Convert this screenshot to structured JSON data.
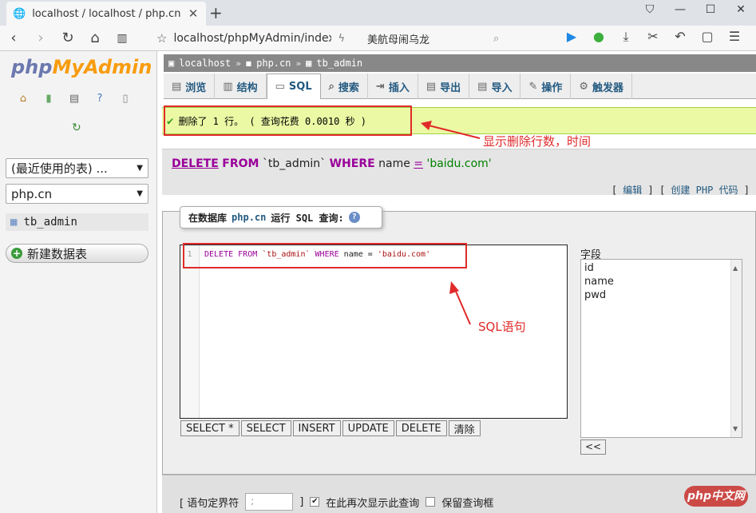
{
  "browser": {
    "tab_title": "localhost / localhost / php.cn / tb",
    "url": "localhost/phpMyAdmin/index.p",
    "search_text": "美航母闹乌龙"
  },
  "sidebar": {
    "logo_php": "php",
    "logo_myadmin": "MyAdmin",
    "recent_tables": "(最近使用的表) ...",
    "database": "php.cn",
    "table": "tb_admin",
    "new_table": "新建数据表"
  },
  "breadcrumb": {
    "server": "localhost",
    "database": "php.cn",
    "table": "tb_admin"
  },
  "tabs": [
    "浏览",
    "结构",
    "SQL",
    "搜索",
    "插入",
    "导出",
    "导入",
    "操作",
    "触发器"
  ],
  "message": "删除了 1 行。 ( 查询花费 0.0010 秒 )",
  "annotation_delete": "显示删除行数，时间",
  "annotation_sql": "SQL语句",
  "query_display": {
    "delete": "DELETE",
    "from": "FROM",
    "table": "`tb_admin`",
    "where": "WHERE",
    "col": "name",
    "eq": "=",
    "value": "'baidu.com'"
  },
  "edit_links": {
    "edit": "编辑",
    "create_php": "创建 PHP 代码"
  },
  "sql_panel": {
    "legend_prefix": "在数据库",
    "legend_db": "php.cn",
    "legend_suffix": "运行 SQL 查询:",
    "line_number": "1",
    "code": {
      "delete": "DELETE",
      "from": "FROM",
      "table": "`tb_admin`",
      "where": "WHERE",
      "col": "name",
      "eq": "=",
      "value": "'baidu.com'"
    },
    "buttons": [
      "SELECT *",
      "SELECT",
      "INSERT",
      "UPDATE",
      "DELETE",
      "清除"
    ],
    "fields_label": "字段",
    "fields": [
      "id",
      "name",
      "pwd"
    ],
    "insert_button": "<<"
  },
  "bottom": {
    "delimiter_label": "[ 语句定界符",
    "delimiter_value": ";",
    "delimiter_close": "]",
    "show_again": "在此再次显示此查询",
    "keep_box": "保留查询框"
  },
  "watermark": "php中文网"
}
